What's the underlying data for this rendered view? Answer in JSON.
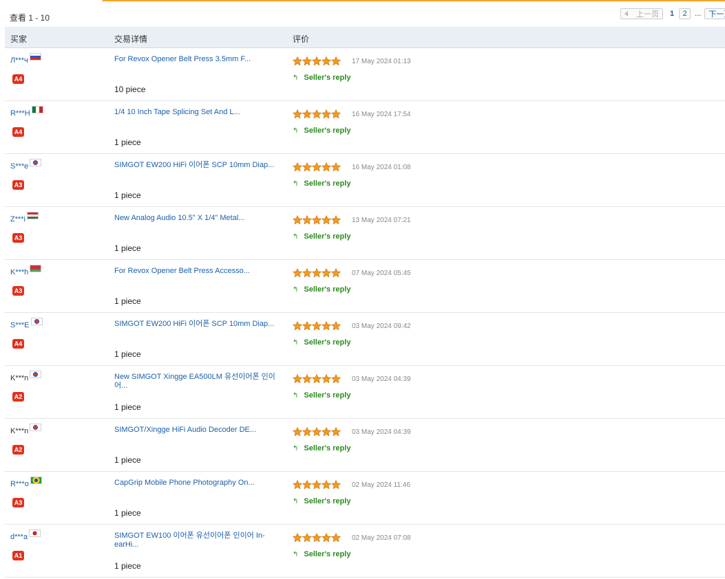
{
  "view_count": "查看 1 - 10",
  "pager": {
    "prev": "上一页",
    "current": "1",
    "page2": "2",
    "ellipsis": "...",
    "next": "下一页"
  },
  "header": {
    "buyer": "买家",
    "details": "交易详情",
    "rating": "评价"
  },
  "colors": {
    "link": "#1a5fa8",
    "reply": "#2a8a1e",
    "badge": "#e0321e",
    "star": "#f39a1e",
    "header_bg": "#eaeef5"
  },
  "rows": [
    {
      "buyer": "Л***ч",
      "flag": "flag-ru",
      "level": "A4",
      "product": "For Revox Opener Belt Press 3.5mm F...",
      "qty": "10 piece",
      "stars": 5,
      "date": "17 May 2024 01:13",
      "reply": "Seller's reply"
    },
    {
      "buyer": "R***H",
      "flag": "flag-mx",
      "level": "A4",
      "product": "1/4 10 Inch Tape Splicing Set And L...",
      "qty": "1 piece",
      "stars": 5,
      "date": "16 May 2024 17:54",
      "reply": "Seller's reply"
    },
    {
      "buyer": "S***e",
      "flag": "flag-kr",
      "level": "A3",
      "product": "SIMGOT EW200 HiFi 이어폰 SCP 10mm Diap...",
      "qty": "1 piece",
      "stars": 5,
      "date": "16 May 2024 01:08",
      "reply": "Seller's reply"
    },
    {
      "buyer": "Z***i",
      "flag": "flag-hu",
      "level": "A3",
      "product": "New Analog Audio 10.5\" X 1/4\" Metal...",
      "qty": "1 piece",
      "stars": 5,
      "date": "13 May 2024 07:21",
      "reply": "Seller's reply"
    },
    {
      "buyer": "K***h",
      "flag": "flag-by",
      "level": "A3",
      "product": "For Revox Opener Belt Press Accesso...",
      "qty": "1 piece",
      "stars": 5,
      "date": "07 May 2024 05:45",
      "reply": "Seller's reply"
    },
    {
      "buyer": "S***E",
      "flag": "flag-kr",
      "level": "A4",
      "product": "SIMGOT EW200 HiFi 이어폰 SCP 10mm Diap...",
      "qty": "1 piece",
      "stars": 5,
      "date": "03 May 2024 09:42",
      "reply": "Seller's reply"
    },
    {
      "buyer": "K***n",
      "flag": "flag-kr",
      "level": "A2",
      "product": "New SIMGOT Xingge EA500LM 유선이어폰 인이어...",
      "qty": "1 piece",
      "stars": 5,
      "date": "03 May 2024 04:39",
      "reply": "Seller's reply",
      "dark": true
    },
    {
      "buyer": "K***n",
      "flag": "flag-kr",
      "level": "A2",
      "product": "SIMGOT/Xingge HiFi Audio Decoder DE...",
      "qty": "1 piece",
      "stars": 5,
      "date": "03 May 2024 04:39",
      "reply": "Seller's reply",
      "dark": true
    },
    {
      "buyer": "R***o",
      "flag": "flag-br",
      "level": "A3",
      "product": "CapGrip Mobile Phone Photography On...",
      "qty": "1 piece",
      "stars": 5,
      "date": "02 May 2024 11:46",
      "reply": "Seller's reply"
    },
    {
      "buyer": "d***a",
      "flag": "flag-jp",
      "level": "A1",
      "product": "SIMGOT EW100 이어폰 유선이어폰 인이어 In-earHi...",
      "qty": "1 piece",
      "stars": 5,
      "date": "02 May 2024 07:08",
      "reply": "Seller's reply"
    }
  ]
}
